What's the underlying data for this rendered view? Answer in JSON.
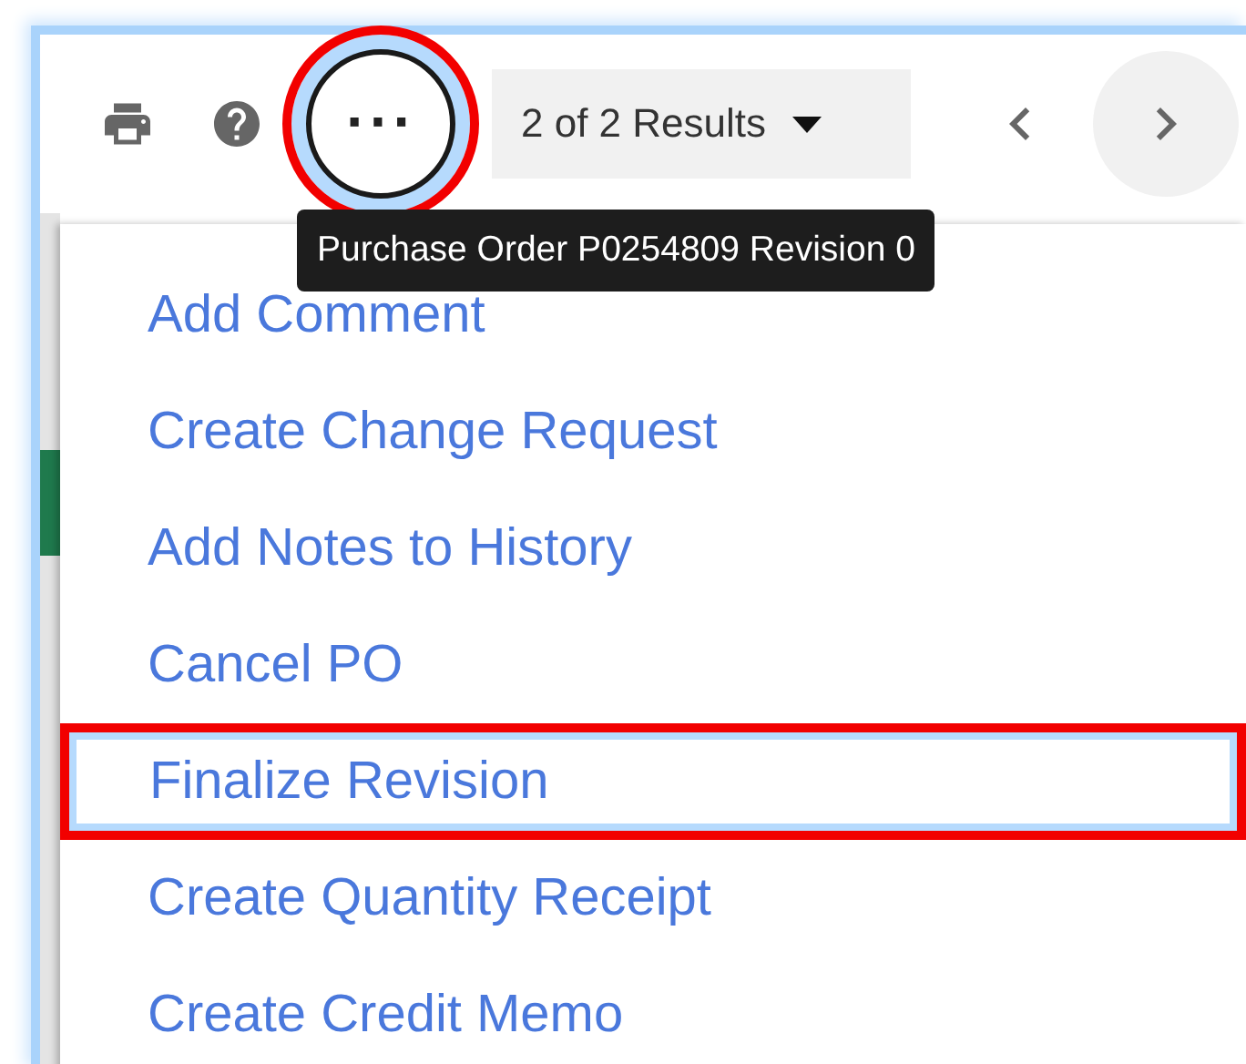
{
  "toolbar": {
    "more_button": {
      "label": "···",
      "annotated": true
    },
    "results": {
      "label": "2 of 2 Results"
    }
  },
  "tooltip": {
    "text": "Purchase Order P0254809 Revision 0"
  },
  "menu": {
    "items": [
      {
        "label": "Add Comment",
        "annotated": false
      },
      {
        "label": "Create Change Request",
        "annotated": false
      },
      {
        "label": "Add Notes to History",
        "annotated": false
      },
      {
        "label": "Cancel PO",
        "annotated": false
      },
      {
        "label": "Finalize Revision",
        "annotated": true
      },
      {
        "label": "Create Quantity Receipt",
        "annotated": false
      },
      {
        "label": "Create Credit Memo",
        "annotated": false
      }
    ]
  }
}
